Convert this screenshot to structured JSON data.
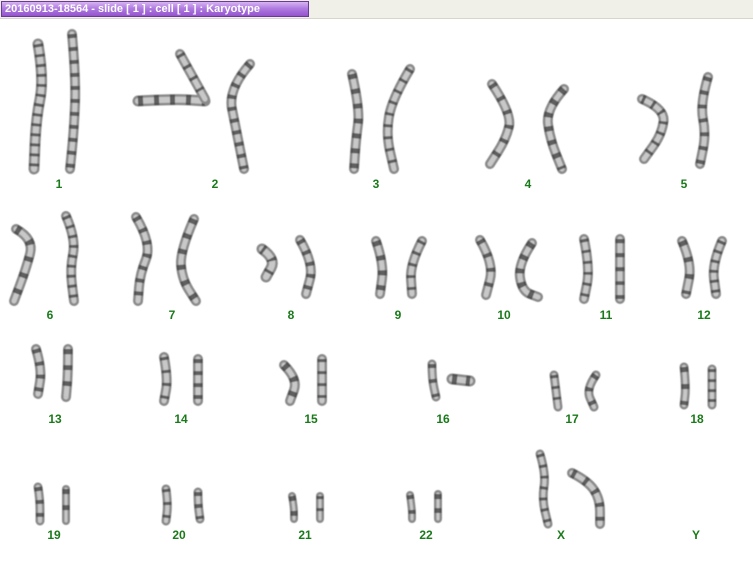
{
  "window": {
    "title": "20160913-18564 - slide [ 1 ] : cell [ 1 ] : Karyotype"
  },
  "karyotype": {
    "labels": [
      "1",
      "2",
      "3",
      "4",
      "5",
      "6",
      "7",
      "8",
      "9",
      "10",
      "11",
      "12",
      "13",
      "14",
      "15",
      "16",
      "17",
      "18",
      "19",
      "20",
      "21",
      "22",
      "X",
      "Y"
    ]
  },
  "colors": {
    "label_green": "#1a7a1a",
    "tab_purple": "#a46ad8"
  }
}
